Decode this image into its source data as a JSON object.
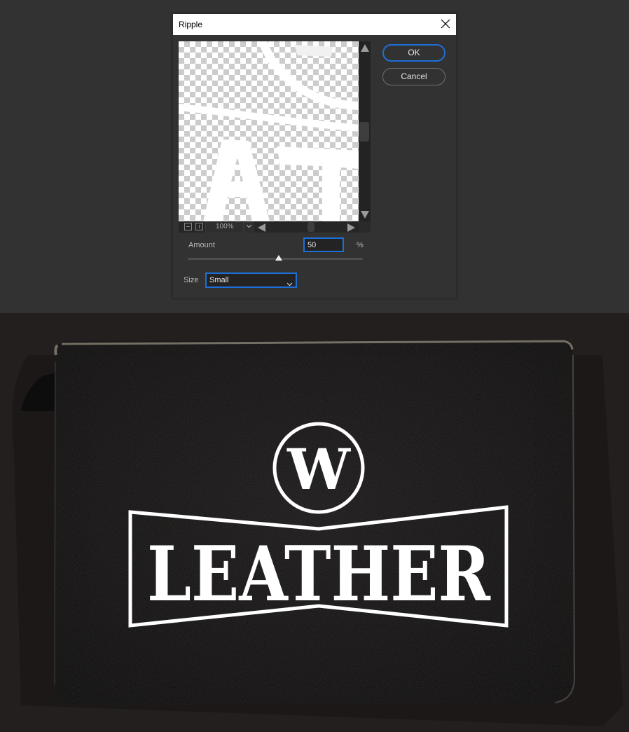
{
  "dialog": {
    "title": "Ripple",
    "close_icon": "close-icon",
    "buttons": {
      "ok": "OK",
      "cancel": "Cancel"
    },
    "preview": {
      "zoom_level": "100%",
      "zoom_out_icon": "zoom-out-icon",
      "zoom_in_icon": "zoom-in-icon"
    },
    "amount": {
      "label": "Amount",
      "value": "50",
      "unit": "%",
      "slider_fraction": 0.52
    },
    "size": {
      "label": "Size",
      "selected": "Small"
    }
  },
  "artwork": {
    "monogram": "W",
    "wordmark": "LEATHER",
    "preview_letters": "AT"
  },
  "colors": {
    "accent": "#1d6fd8",
    "panel": "#323232",
    "leather": "#151414",
    "logo": "#ffffff"
  }
}
